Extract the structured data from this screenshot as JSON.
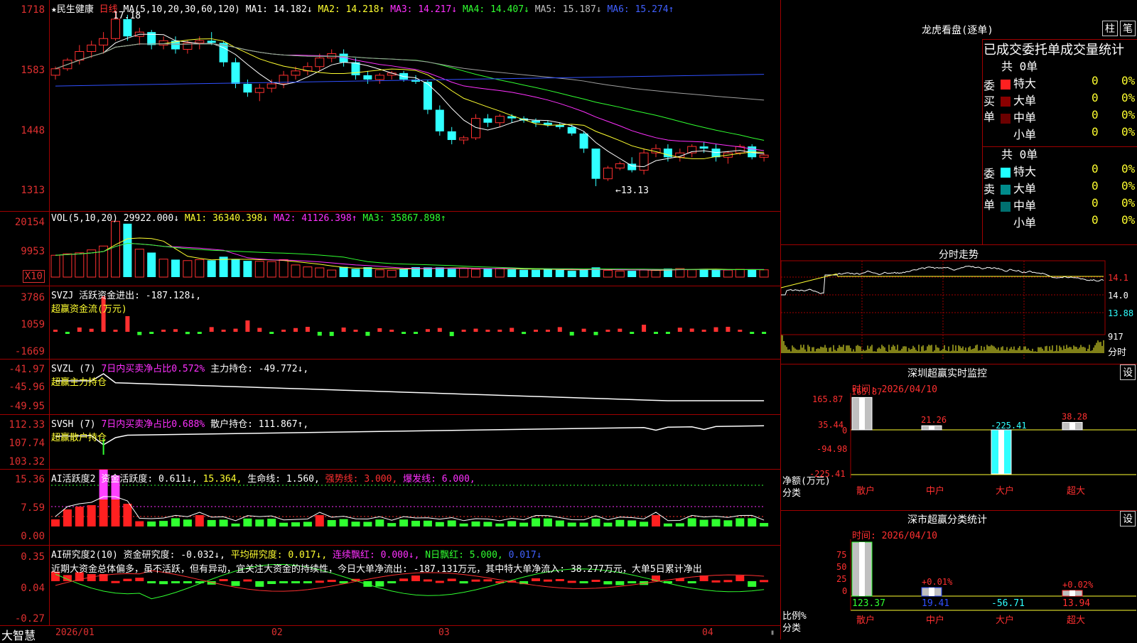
{
  "stock": {
    "name": "★民生健康",
    "period": "日线"
  },
  "kline": {
    "header": {
      "ma_label": "MA(5,10,20,30,60,120)",
      "ma1": "MA1: 14.182↓",
      "ma2": "MA2: 14.218↑",
      "ma3": "MA3: 14.217↓",
      "ma4": "MA4: 14.407↓",
      "ma5": "MA5: 15.187↓",
      "ma6": "MA6: 15.274↑"
    },
    "yticks": [
      "1718",
      "1583",
      "1448",
      "1313"
    ],
    "high_label": "17.18",
    "low_label": "←13.13"
  },
  "vol": {
    "header": {
      "label": "VOL(5,10,20)",
      "value": "29922.000↓",
      "ma1": "MA1: 36340.398↓",
      "ma2": "MA2: 41126.398↑",
      "ma3": "MA3: 35867.898↑"
    },
    "yticks": [
      "20154",
      "9953"
    ],
    "unit": "X10"
  },
  "svzj": {
    "header": {
      "label": "SVZJ",
      "text": "活跃资金进出: -187.128↓,"
    },
    "sub": "超赢资金流(万元)",
    "yticks": [
      "3786",
      "1059",
      "-1669"
    ]
  },
  "svzl": {
    "header": {
      "label": "SVZL (7)",
      "pct": "7日内买卖净占比0.572%",
      "hold": "主力持仓: -49.772↓,"
    },
    "sub": "超赢主力持仓",
    "yticks": [
      "-41.97",
      "-45.96",
      "-49.95"
    ]
  },
  "svsh": {
    "header": {
      "label": "SVSH (7)",
      "pct": "7日内买卖净占比0.688%",
      "hold": "散户持仓: 111.867↑,"
    },
    "sub": "超赢散户持仓",
    "yticks": [
      "112.33",
      "107.74",
      "103.32"
    ]
  },
  "ai1": {
    "header": {
      "label": "AI活跃度2",
      "a": "资金活跃度: 0.611↓,",
      "b": "15.364,",
      "c": "生命线: 1.560,",
      "d": "强势线: 3.000,",
      "e": "爆发线: 6.000,"
    },
    "yticks": [
      "15.36",
      "7.59",
      "0.00"
    ]
  },
  "ai2": {
    "header": {
      "label": "AI研究度2(10)",
      "a": "资金研究度: -0.032↓,",
      "b": "平均研究度: 0.017↓,",
      "c": "连续飘红: 0.000↓,",
      "d": "N日飘红: 5.000,",
      "e": "0.017↓"
    },
    "note": "近期大资金总体偏多，虽不活跃，但有异动，宜关注大资金的持续性，今日大单净流出: -187.131万元，其中特大单净流入: 38.277万元，大单5日累计净出",
    "yticks": [
      "0.35",
      "0.04",
      "-0.27"
    ]
  },
  "xaxis": {
    "logo": "大智慧",
    "labels": [
      "2026/01",
      "02",
      "03",
      "04"
    ]
  },
  "right": {
    "lhb": {
      "title": "龙虎看盘(逐单)",
      "btn1": "柱",
      "btn2": "笔",
      "sub": "已成交委托单成交量统计",
      "buy": {
        "side": "委买单",
        "total": "共 0单",
        "rows": [
          {
            "name": "特大",
            "v": "0",
            "p": "0%",
            "c": "#ff2020"
          },
          {
            "name": "大单",
            "v": "0",
            "p": "0%",
            "c": "#8b0000"
          },
          {
            "name": "中单",
            "v": "0",
            "p": "0%",
            "c": "#6b0000"
          },
          {
            "name": "小单",
            "v": "0",
            "p": "0%",
            "c": "#000000"
          }
        ]
      },
      "sell": {
        "side": "委卖单",
        "total": "共 0单",
        "rows": [
          {
            "name": "特大",
            "v": "0",
            "p": "0%",
            "c": "#20ffff"
          },
          {
            "name": "大单",
            "v": "0",
            "p": "0%",
            "c": "#008b8b"
          },
          {
            "name": "中单",
            "v": "0",
            "p": "0%",
            "c": "#007070"
          },
          {
            "name": "小单",
            "v": "0",
            "p": "0%",
            "c": "#000000"
          }
        ]
      }
    },
    "fs": {
      "title": "分时走势",
      "prices": [
        "14.1",
        "14.0",
        "13.88"
      ],
      "vol": "917",
      "unit": "分时"
    },
    "sz": {
      "title": "深圳超赢实时监控",
      "btn": "设",
      "time": "时间: 2026/04/10",
      "yticks": [
        "165.87",
        "35.44",
        "0",
        "-94.98",
        "-225.41"
      ],
      "ylabel": "净额(万元)",
      "xlabel": "分类",
      "bars": [
        {
          "cat": "散户",
          "v": "165.87"
        },
        {
          "cat": "中户",
          "v": "21.26"
        },
        {
          "cat": "大户",
          "v": "-225.41"
        },
        {
          "cat": "超大",
          "v": "38.28"
        }
      ]
    },
    "fl": {
      "title": "深市超赢分类统计",
      "btn": "设",
      "time": "时间: 2026/04/10",
      "yticks": [
        "75",
        "50",
        "25",
        "0"
      ],
      "ylabel": "比例%",
      "xlabel": "分类",
      "bars": [
        {
          "cat": "散户",
          "v": "123.37",
          "t": ""
        },
        {
          "cat": "中户",
          "v": "19.41",
          "t": "+0.01%"
        },
        {
          "cat": "大户",
          "v": "-56.71",
          "t": ""
        },
        {
          "cat": "超大",
          "v": "13.94",
          "t": "+0.02%"
        }
      ]
    }
  },
  "chart_data": [
    {
      "type": "candlestick",
      "title": "民生健康 日线",
      "ylim": [
        13.13,
        17.18
      ],
      "series": [
        {
          "name": "K",
          "values": [
            [
              15.7,
              15.9,
              15.6,
              15.85
            ],
            [
              15.85,
              16.1,
              15.8,
              16.05
            ],
            [
              16.05,
              16.4,
              15.95,
              16.25
            ],
            [
              16.25,
              16.5,
              16.1,
              16.4
            ],
            [
              16.4,
              16.7,
              16.2,
              16.55
            ],
            [
              16.55,
              17.18,
              16.5,
              17.0
            ],
            [
              17.0,
              17.1,
              16.5,
              16.6
            ],
            [
              16.6,
              16.8,
              16.4,
              16.7
            ],
            [
              16.7,
              16.75,
              16.3,
              16.4
            ],
            [
              16.4,
              16.6,
              16.3,
              16.5
            ],
            [
              16.5,
              16.6,
              16.2,
              16.3
            ],
            [
              16.3,
              16.5,
              16.2,
              16.45
            ],
            [
              16.45,
              16.6,
              16.3,
              16.5
            ],
            [
              16.5,
              16.7,
              16.4,
              16.45
            ],
            [
              16.45,
              16.5,
              15.9,
              16.0
            ],
            [
              16.0,
              16.1,
              15.4,
              15.5
            ],
            [
              15.5,
              15.6,
              15.2,
              15.3
            ],
            [
              15.3,
              15.5,
              15.1,
              15.4
            ],
            [
              15.4,
              15.6,
              15.3,
              15.5
            ],
            [
              15.5,
              15.8,
              15.4,
              15.7
            ],
            [
              15.7,
              15.9,
              15.6,
              15.8
            ],
            [
              15.8,
              16.0,
              15.7,
              15.9
            ],
            [
              15.9,
              16.2,
              15.8,
              16.1
            ],
            [
              16.1,
              16.3,
              16.0,
              16.2
            ],
            [
              16.2,
              16.3,
              15.9,
              16.0
            ],
            [
              16.0,
              16.1,
              15.6,
              15.7
            ],
            [
              15.7,
              15.8,
              15.5,
              15.6
            ],
            [
              15.6,
              15.75,
              15.5,
              15.7
            ],
            [
              15.7,
              15.8,
              15.6,
              15.75
            ],
            [
              15.75,
              15.8,
              15.55,
              15.6
            ],
            [
              15.6,
              15.7,
              15.5,
              15.55
            ],
            [
              15.55,
              15.6,
              14.8,
              14.9
            ],
            [
              14.9,
              15.0,
              14.3,
              14.4
            ],
            [
              14.4,
              14.5,
              14.1,
              14.2
            ],
            [
              14.2,
              14.3,
              14.1,
              14.25
            ],
            [
              14.25,
              14.8,
              14.2,
              14.7
            ],
            [
              14.7,
              14.8,
              14.5,
              14.6
            ],
            [
              14.6,
              14.8,
              14.5,
              14.75
            ],
            [
              14.75,
              14.8,
              14.6,
              14.7
            ],
            [
              14.7,
              14.75,
              14.6,
              14.65
            ],
            [
              14.65,
              14.7,
              14.5,
              14.6
            ],
            [
              14.6,
              14.65,
              14.5,
              14.55
            ],
            [
              14.55,
              14.6,
              14.45,
              14.5
            ],
            [
              14.5,
              14.55,
              14.3,
              14.35
            ],
            [
              14.35,
              14.4,
              13.9,
              14.0
            ],
            [
              14.0,
              14.0,
              13.13,
              13.3
            ],
            [
              13.3,
              13.6,
              13.25,
              13.55
            ],
            [
              13.55,
              13.7,
              13.5,
              13.65
            ],
            [
              13.65,
              13.8,
              13.45,
              13.5
            ],
            [
              13.5,
              14.0,
              13.4,
              13.9
            ],
            [
              13.9,
              14.1,
              13.8,
              14.0
            ],
            [
              14.0,
              14.1,
              13.7,
              13.8
            ],
            [
              13.8,
              14.0,
              13.7,
              13.9
            ],
            [
              13.9,
              14.1,
              13.8,
              14.05
            ],
            [
              14.05,
              14.15,
              13.9,
              14.0
            ],
            [
              14.0,
              14.1,
              13.7,
              13.8
            ],
            [
              13.8,
              13.95,
              13.65,
              13.9
            ],
            [
              13.9,
              14.1,
              13.85,
              14.05
            ],
            [
              14.05,
              14.1,
              13.75,
              13.8
            ],
            [
              13.8,
              13.9,
              13.7,
              13.85
            ]
          ]
        }
      ]
    },
    {
      "type": "bar",
      "title": "VOL(5,10,20)",
      "ylim": [
        0,
        24000
      ],
      "series": [
        {
          "name": "VOL",
          "values": [
            9000,
            9600,
            10000,
            11200,
            12800,
            23000,
            22000,
            11500,
            10100,
            7400,
            7200,
            6800,
            7200,
            6900,
            8400,
            7400,
            6700,
            6500,
            6400,
            7200,
            5000,
            4200,
            3800,
            2900,
            4200,
            3400,
            4100,
            3000,
            2800,
            3400,
            4100,
            4000,
            4000,
            3400,
            3600,
            3200,
            3600,
            3600,
            3200,
            3000,
            3000,
            3400,
            3000,
            2600,
            3100,
            4000,
            2800,
            2500,
            2600,
            3000,
            2800,
            3500,
            3500,
            3000,
            3400,
            3000,
            2900,
            3200,
            3000,
            3000
          ]
        }
      ]
    }
  ]
}
